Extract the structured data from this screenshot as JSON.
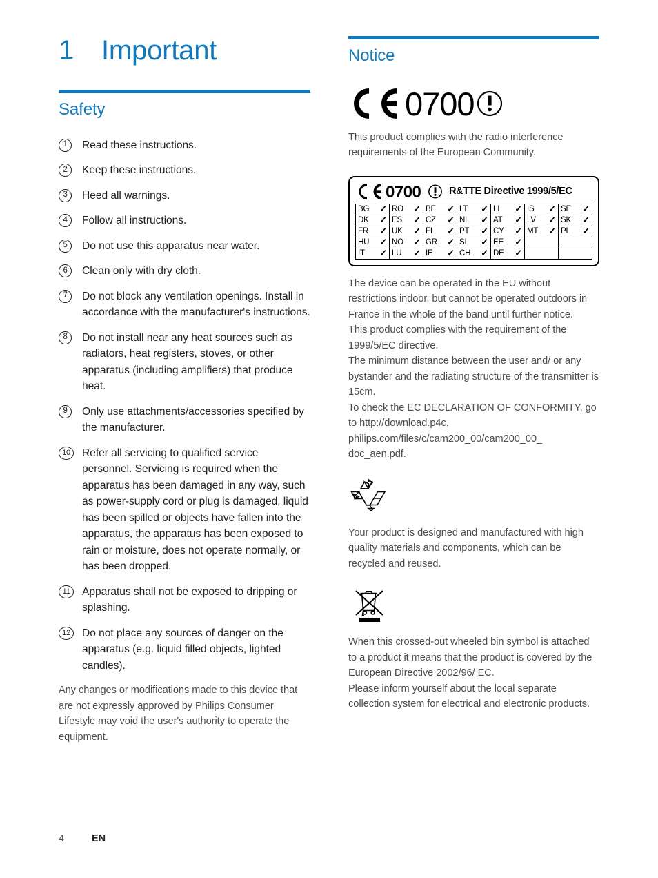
{
  "page": {
    "number": "4",
    "language": "EN",
    "accent_color": "#1278b8",
    "text_color": "#231f20",
    "body_color": "#4c4c4c"
  },
  "chapter": {
    "number": "1",
    "title": "Important"
  },
  "safety": {
    "heading": "Safety",
    "items": [
      {
        "num": "1",
        "text": "Read these instructions."
      },
      {
        "num": "2",
        "text": "Keep these instructions."
      },
      {
        "num": "3",
        "text": "Heed all warnings."
      },
      {
        "num": "4",
        "text": "Follow all instructions."
      },
      {
        "num": "5",
        "text": "Do not use this apparatus near water."
      },
      {
        "num": "6",
        "text": "Clean only with dry cloth."
      },
      {
        "num": "7",
        "text": "Do not block any ventilation openings. Install in accordance with the manufacturer's instructions."
      },
      {
        "num": "8",
        "text": "Do not install near any heat sources such as radiators, heat registers, stoves, or other apparatus (including amplifiers) that produce heat."
      },
      {
        "num": "9",
        "text": "Only use attachments/accessories specified by the manufacturer."
      },
      {
        "num": "10",
        "text": "Refer all servicing to qualified service personnel. Servicing is required when the apparatus has been damaged in any way, such as power-supply cord or plug is damaged, liquid has been spilled or objects have fallen into the apparatus, the apparatus has been exposed to rain or moisture, does not operate normally, or has been dropped."
      },
      {
        "num": "11",
        "text": "Apparatus shall not be exposed to dripping or splashing."
      },
      {
        "num": "12",
        "text": "Do not place any sources of danger on the apparatus (e.g. liquid filled objects, lighted candles)."
      }
    ],
    "closing_paragraph": "Any changes or modifications made to this device that are not expressly approved by Philips Consumer Lifestyle may void the user's authority to operate the equipment."
  },
  "notice": {
    "heading": "Notice",
    "ce_mark": {
      "ce_text": "CE",
      "notified_body_number": "0700",
      "alert_symbol": "!"
    },
    "intro_paragraph": "This product complies with the radio interference requirements of the European Community.",
    "rtte": {
      "ce_text": "CE",
      "notified_body_number": "0700",
      "alert_symbol": "!",
      "directive_label": "R&TTE Directive  1999/5/EC",
      "tick_mark": "✓",
      "rows": [
        [
          "BG",
          "RO",
          "BE",
          "LT",
          "LI",
          "IS",
          "SE"
        ],
        [
          "DK",
          "ES",
          "CZ",
          "NL",
          "AT",
          "LV",
          "SK"
        ],
        [
          "FR",
          "UK",
          "FI",
          "PT",
          "CY",
          "MT",
          "PL"
        ],
        [
          "HU",
          "NO",
          "GR",
          "SI",
          "EE",
          "",
          ""
        ],
        [
          "IT",
          "LU",
          "IE",
          "CH",
          "DE",
          "",
          ""
        ]
      ]
    },
    "paragraphs": [
      "The device can be operated in the EU without restrictions indoor, but cannot be operated outdoors in France in the whole of the band until further notice.",
      "This product complies with the requirement of the 1999/5/EC directive.",
      "The minimum distance between the user and/ or any bystander and the radiating structure of the transmitter is 15cm.",
      "To check the EC DECLARATION OF CONFORMITY, go to http://download.p4c. philips.com/files/c/cam200_00/cam200_00_ doc_aen.pdf."
    ],
    "recycle": {
      "symbol_name": "recycling-mobius-loop",
      "paragraph": "Your product is designed and manufactured with high quality materials and components, which can be recycled and reused."
    },
    "weee": {
      "symbol_name": "crossed-out-wheeled-bin",
      "paragraphs": [
        "When this crossed-out wheeled bin symbol is attached to a product it means that the product is covered by the European Directive 2002/96/ EC.",
        "Please inform yourself about the local separate collection system for electrical and electronic products."
      ]
    }
  }
}
